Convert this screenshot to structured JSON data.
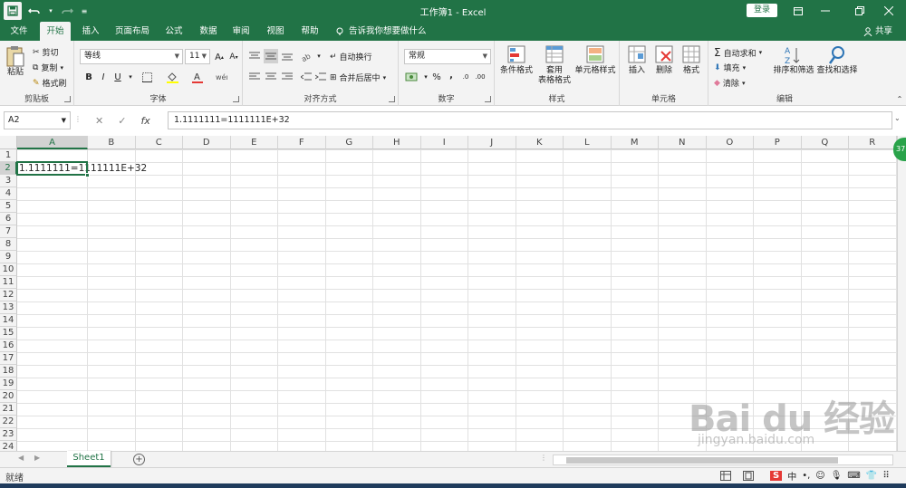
{
  "window": {
    "title": "工作簿1  -  Excel",
    "login": "登录"
  },
  "tabs": [
    {
      "label": "文件"
    },
    {
      "label": "开始"
    },
    {
      "label": "插入"
    },
    {
      "label": "页面布局"
    },
    {
      "label": "公式"
    },
    {
      "label": "数据"
    },
    {
      "label": "审阅"
    },
    {
      "label": "视图"
    },
    {
      "label": "帮助"
    }
  ],
  "tellme": "告诉我你想要做什么",
  "share": "共享",
  "ribbon": {
    "clipboard": {
      "label": "剪贴板",
      "paste": "粘贴",
      "cut": "剪切",
      "copy": "复制",
      "format_painter": "格式刷"
    },
    "font": {
      "label": "字体",
      "font_name": "等线",
      "font_size": "11",
      "bold": "B",
      "italic": "I",
      "underline": "U"
    },
    "alignment": {
      "label": "对齐方式",
      "wrap": "自动换行",
      "merge": "合并后居中"
    },
    "number": {
      "label": "数字",
      "format": "常规",
      "percent": "%",
      "comma": ","
    },
    "styles": {
      "label": "样式",
      "conditional": "条件格式",
      "table": "套用\n表格格式",
      "cell_styles": "单元格样式"
    },
    "cells": {
      "label": "单元格",
      "insert": "插入",
      "delete": "删除",
      "format": "格式"
    },
    "editing": {
      "label": "编辑",
      "autosum": "自动求和",
      "fill": "填充",
      "clear": "清除",
      "sort": "排序和筛选",
      "find": "查找和选择"
    }
  },
  "formula_bar": {
    "name_box": "A2",
    "fx": "fx",
    "content": "1.1111111=1111111E+32"
  },
  "grid": {
    "columns": [
      "A",
      "B",
      "C",
      "D",
      "E",
      "F",
      "G",
      "H",
      "I",
      "J",
      "K",
      "L",
      "M",
      "N",
      "O",
      "P",
      "Q",
      "R"
    ],
    "rows": [
      "1",
      "2",
      "3",
      "4",
      "5",
      "6",
      "7",
      "8",
      "9",
      "10",
      "11",
      "12",
      "13",
      "14",
      "15",
      "16",
      "17",
      "18",
      "19",
      "20",
      "21",
      "22",
      "23",
      "24"
    ],
    "cells": [
      {
        "ref": "A2",
        "value": "1.1111111=1111111E+32"
      }
    ]
  },
  "sheets": [
    {
      "name": "Sheet1",
      "active": true
    }
  ],
  "status": {
    "text": "就绪"
  },
  "floating_badge": "37",
  "watermark": {
    "main": "Bai du 经验",
    "sub": "jingyan.baidu.com"
  },
  "colors": {
    "accent": "#217346"
  }
}
